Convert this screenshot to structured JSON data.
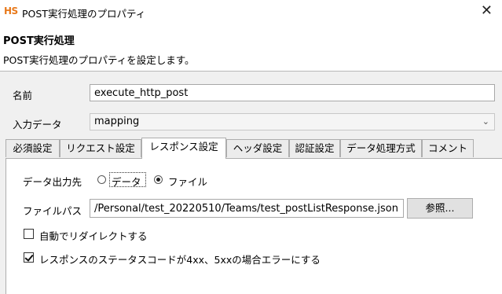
{
  "window": {
    "app_icon_text": "HS",
    "title": "POST実行処理のプロパティ",
    "close_glyph": "✕"
  },
  "header": {
    "title": "POST実行処理",
    "description": "POST実行処理のプロパティを設定します。"
  },
  "form": {
    "name_label": "名前",
    "name_value": "execute_http_post",
    "input_data_label": "入力データ",
    "input_data_value": "mapping"
  },
  "tabs": [
    {
      "label": "必須設定"
    },
    {
      "label": "リクエスト設定"
    },
    {
      "label": "レスポンス設定",
      "active": true
    },
    {
      "label": "ヘッダ設定"
    },
    {
      "label": "認証設定"
    },
    {
      "label": "データ処理方式"
    },
    {
      "label": "コメント"
    }
  ],
  "response": {
    "output_label": "データ出力先",
    "option_data": "データ",
    "option_file": "ファイル",
    "selected": "ファイル",
    "file_path_label": "ファイルパス",
    "file_path_value": "/Personal/test_20220510/Teams/test_postListResponse.json",
    "browse_label": "参照...",
    "redirect_label": "自動でリダイレクトする",
    "redirect_checked": false,
    "error_label": "レスポンスのステータスコードが4xx、5xxの場合エラーにする",
    "error_checked": true
  }
}
